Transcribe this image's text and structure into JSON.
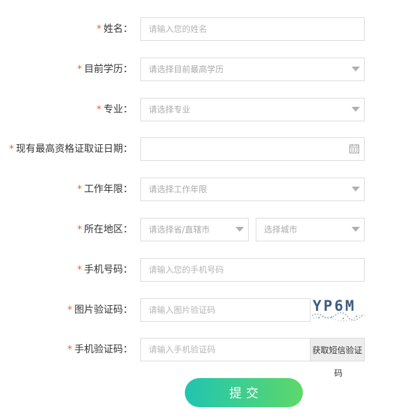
{
  "required_mark": "*",
  "fields": {
    "name": {
      "label": "姓名：",
      "placeholder": "请输入您的姓名"
    },
    "education": {
      "label": "目前学历：",
      "placeholder": "请选择目前最高学历"
    },
    "major": {
      "label": "专业：",
      "placeholder": "请选择专业"
    },
    "cert_date": {
      "label": "现有最高资格证取证日期：",
      "value": ""
    },
    "work_years": {
      "label": "工作年限：",
      "placeholder": "请选择工作年限"
    },
    "region": {
      "label": "所在地区：",
      "province_placeholder": "请选择省/直辖市",
      "city_placeholder": "选择城市"
    },
    "phone": {
      "label": "手机号码：",
      "placeholder": "请输入您的手机号码"
    },
    "image_code": {
      "label": "图片验证码：",
      "placeholder": "请输入图片验证码",
      "captcha_text": "YP6M"
    },
    "sms_code": {
      "label": "手机验证码：",
      "placeholder": "请输入手机验证码",
      "button_line1": "获取短信验证",
      "button_line2": "码"
    }
  },
  "submit_label": "提交",
  "colors": {
    "required": "#f0612d",
    "button_start": "#21c4b1",
    "button_end": "#5dd86a"
  },
  "icons": {
    "dropdown": "chevron-down-icon",
    "date": "calendar-icon"
  }
}
